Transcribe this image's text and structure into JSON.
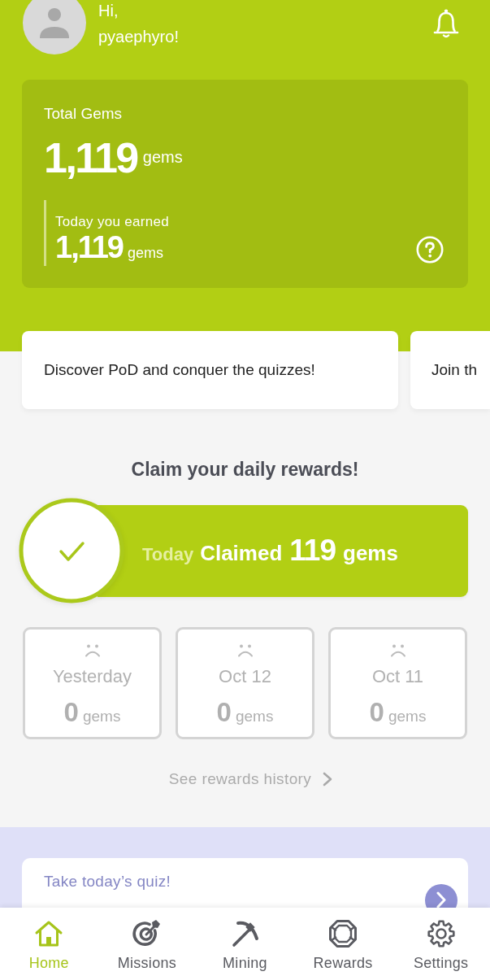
{
  "header": {
    "greeting": "Hi,",
    "username": "pyaephyro!"
  },
  "gems_card": {
    "title": "Total Gems",
    "total": "1,119",
    "total_unit": "gems",
    "today_label": "Today you earned",
    "today": "1,119",
    "today_unit": "gems"
  },
  "banners": [
    {
      "text": "Discover PoD and conquer the quizzes!"
    },
    {
      "text": "Join th"
    }
  ],
  "daily_rewards": {
    "title": "Claim your daily rewards!",
    "today": {
      "label": "Today",
      "status": "Claimed",
      "amount": "119",
      "unit": "gems",
      "claimed": true
    },
    "past_days": [
      {
        "label": "Yesterday",
        "amount": "0",
        "unit": "gems",
        "claimed": false
      },
      {
        "label": "Oct 12",
        "amount": "0",
        "unit": "gems",
        "claimed": false
      },
      {
        "label": "Oct 11",
        "amount": "0",
        "unit": "gems",
        "claimed": false
      }
    ],
    "history_link": "See rewards history"
  },
  "quiz": {
    "title": "Take today’s quiz!"
  },
  "nav": [
    {
      "label": "Home",
      "selected": true
    },
    {
      "label": "Missions",
      "selected": false
    },
    {
      "label": "Mining",
      "selected": false
    },
    {
      "label": "Rewards",
      "selected": false
    },
    {
      "label": "Settings",
      "selected": false
    }
  ]
}
